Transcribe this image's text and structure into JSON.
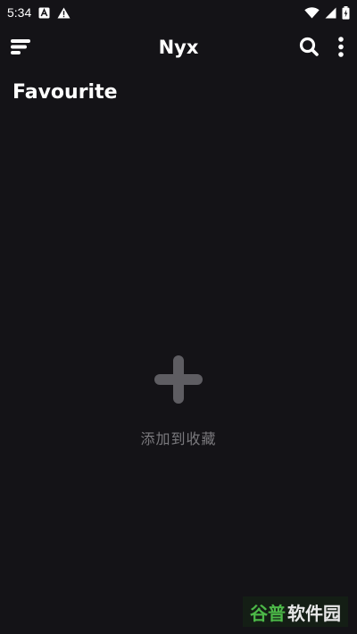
{
  "status_bar": {
    "time": "5:34",
    "icons": [
      "notification-a-icon",
      "warning-icon",
      "wifi-icon",
      "signal-icon",
      "battery-icon"
    ]
  },
  "app_bar": {
    "title": "Nyx",
    "left_icon": "menu-icon",
    "right_icons": [
      "search-icon",
      "more-vert-icon"
    ]
  },
  "main": {
    "section_title": "Favourite",
    "empty_state": {
      "icon": "plus-icon",
      "label": "添加到收藏"
    }
  },
  "watermark": {
    "brand": "谷普",
    "rest": "软件园"
  },
  "colors": {
    "background": "#141317",
    "text_primary": "#ffffff",
    "text_muted": "#7a797d",
    "icon_muted": "#5e5d62",
    "watermark_green": "#4cb848"
  }
}
